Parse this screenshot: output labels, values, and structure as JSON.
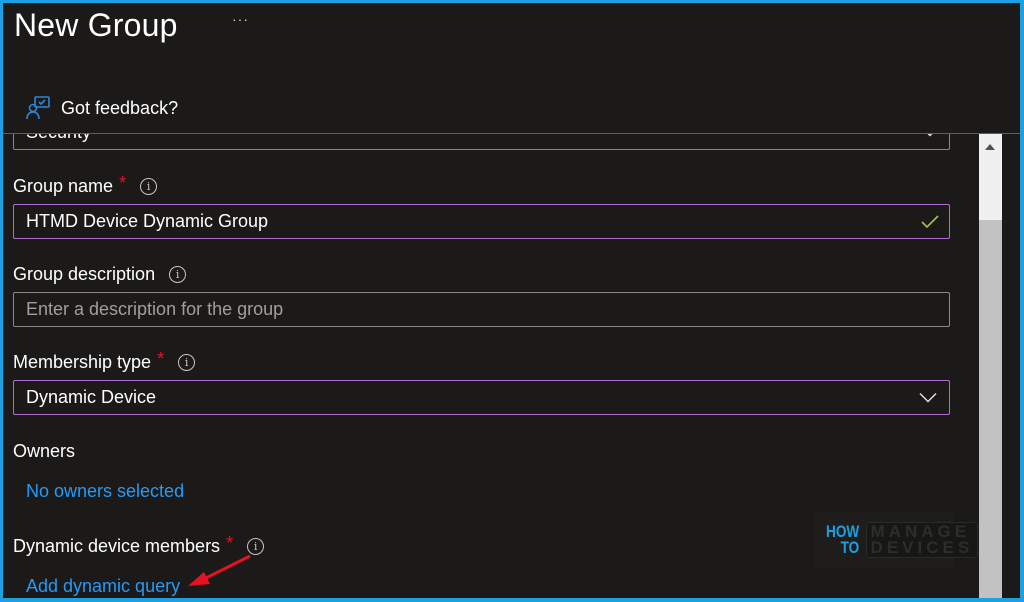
{
  "header": {
    "title": "New Group",
    "more_label": "···",
    "feedback_label": "Got feedback?"
  },
  "form": {
    "group_type": {
      "value": "Security"
    },
    "group_name": {
      "label": "Group name",
      "required": "*",
      "value": "HTMD Device Dynamic Group",
      "valid": true
    },
    "group_description": {
      "label": "Group description",
      "placeholder": "Enter a description for the group",
      "value": ""
    },
    "membership_type": {
      "label": "Membership type",
      "required": "*",
      "value": "Dynamic Device"
    },
    "owners": {
      "label": "Owners",
      "link": "No owners selected"
    },
    "dynamic_members": {
      "label": "Dynamic device members",
      "required": "*",
      "link": "Add dynamic query"
    }
  },
  "icons": {
    "info": "i"
  },
  "watermark": {
    "line1_left": "HOW",
    "line2_left": "TO",
    "line1_right": "MANAGE",
    "line2_right": "DEVICES"
  },
  "colors": {
    "accent_border": "#1ba1e2",
    "link": "#2899f5",
    "focus_border": "#b16bd1",
    "required": "#e81123",
    "valid_check": "#a4c24f",
    "annotation_arrow": "#e81123"
  }
}
